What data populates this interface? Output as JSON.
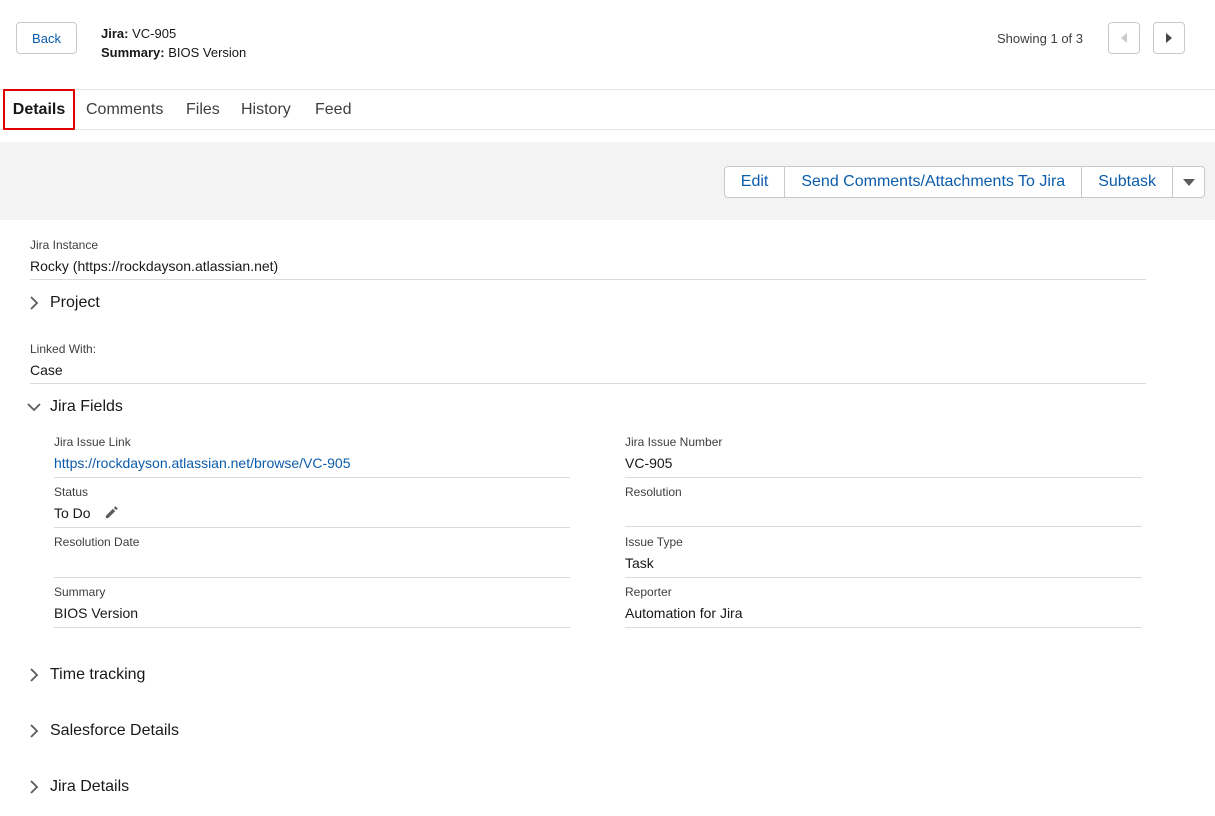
{
  "header": {
    "back_label": "Back",
    "jira_label": "Jira:",
    "jira_value": "VC-905",
    "summary_label": "Summary:",
    "summary_value": "BIOS Version",
    "showing": "Showing 1 of 3"
  },
  "tabs": [
    {
      "label": "Details"
    },
    {
      "label": "Comments"
    },
    {
      "label": "Files"
    },
    {
      "label": "History"
    },
    {
      "label": "Feed"
    }
  ],
  "actions": {
    "edit": "Edit",
    "send": "Send Comments/Attachments To Jira",
    "subtask": "Subtask"
  },
  "top_fields": {
    "instance_label": "Jira Instance",
    "instance_value": "Rocky (https://rockdayson.atlassian.net)",
    "linked_label": "Linked With:",
    "linked_value": "Case"
  },
  "sections": {
    "project": "Project",
    "jira_fields": "Jira Fields",
    "time_tracking": "Time tracking",
    "salesforce_details": "Salesforce Details",
    "jira_details": "Jira Details"
  },
  "jira_fields": {
    "issue_link_label": "Jira Issue Link",
    "issue_link_value": "https://rockdayson.atlassian.net/browse/VC-905",
    "issue_number_label": "Jira Issue Number",
    "issue_number_value": "VC-905",
    "status_label": "Status",
    "status_value": "To Do",
    "resolution_label": "Resolution",
    "resolution_value": "",
    "resolution_date_label": "Resolution Date",
    "resolution_date_value": "",
    "issue_type_label": "Issue Type",
    "issue_type_value": "Task",
    "summary_label": "Summary",
    "summary_value": "BIOS Version",
    "reporter_label": "Reporter",
    "reporter_value": "Automation for Jira"
  },
  "colors": {
    "link": "#0b5cab",
    "active_tab_outline": "#e00000",
    "action_bar_bg": "#f3f3f3"
  },
  "icons": [
    "prev-arrow-icon",
    "next-arrow-icon",
    "dropdown-caret-icon",
    "chevron-right-icon",
    "chevron-down-icon",
    "pencil-icon"
  ]
}
